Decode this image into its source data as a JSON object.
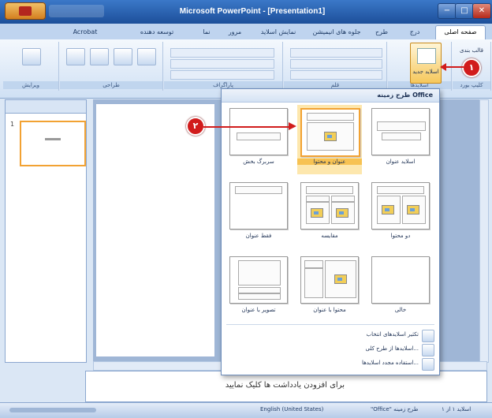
{
  "window": {
    "title": "Microsoft PowerPoint - [Presentation1]",
    "controls": [
      "−",
      "□",
      "✕"
    ]
  },
  "tabs": [
    {
      "label": "صفحه اصلی",
      "active": true
    },
    {
      "label": "درج",
      "active": false
    },
    {
      "label": "طرح",
      "active": false
    },
    {
      "label": "جلوه های انیمیشن",
      "active": false
    },
    {
      "label": "نمایش اسلاید",
      "active": false
    },
    {
      "label": "مرور",
      "active": false
    },
    {
      "label": "نما",
      "active": false
    },
    {
      "label": "توسعه دهنده",
      "active": false
    },
    {
      "label": "Acrobat",
      "active": false
    }
  ],
  "ribbon": {
    "new_slide_label": "اسلاید جدید",
    "layout_label": "قالب بندی",
    "groups": [
      "کلیپ بورد",
      "اسلایدها",
      "قلم",
      "پاراگراف",
      "طراحی",
      "ویرایش"
    ]
  },
  "callouts": {
    "step1": "۱",
    "step2": "۲"
  },
  "gallery": {
    "header": "طرح زمینه Office",
    "layouts": [
      {
        "label": "اسلاید عنوان",
        "kind": "title"
      },
      {
        "label": "عنوان و محتوا",
        "kind": "title-content",
        "selected": true
      },
      {
        "label": "سربرگ بخش",
        "kind": "section"
      },
      {
        "label": "دو محتوا",
        "kind": "two-content"
      },
      {
        "label": "مقایسه",
        "kind": "comparison"
      },
      {
        "label": "فقط عنوان",
        "kind": "title-only"
      },
      {
        "label": "خالی",
        "kind": "blank"
      },
      {
        "label": "محتوا با عنوان",
        "kind": "content-caption"
      },
      {
        "label": "تصویر با عنوان",
        "kind": "picture-caption"
      }
    ],
    "menu": [
      "تکثیر اسلایدهای انتخاب",
      "اسلایدها از طرح کلی...",
      "استفاده مجدد اسلایدها..."
    ]
  },
  "notes_placeholder": "برای افزودن یادداشت ها کلیک نمایید",
  "status": {
    "slide": "اسلاید ۱ از ۱",
    "theme": "\"Office\" طرح زمینه",
    "language": "English (United States)"
  },
  "colors": {
    "accent": "#f2a233",
    "callout": "#d11c1c",
    "titlebar": "#2a61b0"
  }
}
